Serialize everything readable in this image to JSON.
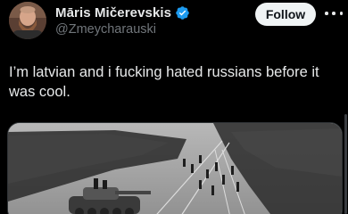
{
  "tweet": {
    "author": {
      "display_name": "Māris Mičerevskis",
      "handle": "@Zmeycharauski",
      "verified": true,
      "avatar_icon": "bearded-man-avatar"
    },
    "follow_label": "Follow",
    "text": "I’m latvian and i fucking hated russians before it was cool.",
    "media": {
      "type": "black-and-white-photo",
      "description_icon": "crowd-with-tank-photo"
    }
  },
  "colors": {
    "background": "#000000",
    "text": "#e7e9ea",
    "secondary_text": "#71767b",
    "verified_blue": "#1d9bf0",
    "follow_bg": "#eff3f4"
  }
}
